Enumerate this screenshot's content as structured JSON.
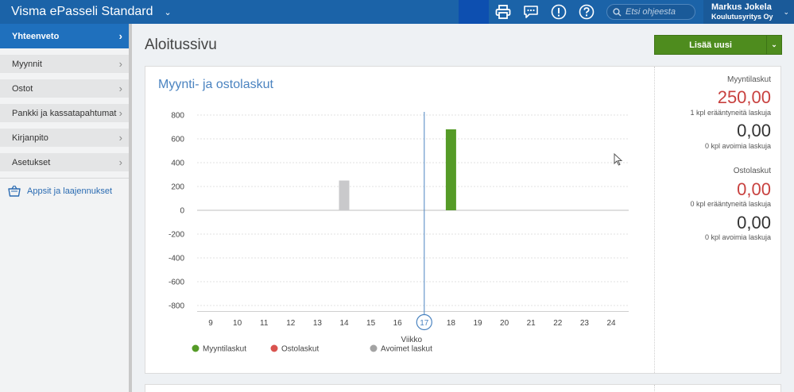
{
  "app": {
    "title": "Visma ePasseli Standard"
  },
  "topbar": {
    "icons": [
      "printer-icon",
      "chat-icon",
      "alert-icon",
      "help-icon"
    ],
    "search_placeholder": "Etsi ohjeesta",
    "user_name": "Markus Jokela",
    "company": "Koulutusyritys Oy"
  },
  "sidebar": {
    "items": [
      {
        "label": "Yhteenveto",
        "active": true
      },
      {
        "label": "Myynnit"
      },
      {
        "label": "Ostot"
      },
      {
        "label": "Pankki ja kassatapahtumat"
      },
      {
        "label": "Kirjanpito"
      },
      {
        "label": "Asetukset"
      }
    ],
    "apps_label": "Appsit ja laajennukset"
  },
  "main": {
    "page_title": "Aloitussivu",
    "add_button": "Lisää uusi",
    "card_title": "Myynti- ja ostolaskut"
  },
  "stats": {
    "sales_heading": "Myyntilaskut",
    "sales_overdue_amount": "250,00",
    "sales_overdue_label": "1 kpl erääntyneitä laskuja",
    "sales_open_amount": "0,00",
    "sales_open_label": "0 kpl avoimia laskuja",
    "purchases_heading": "Ostolaskut",
    "purchases_overdue_amount": "0,00",
    "purchases_overdue_label": "0 kpl erääntyneitä laskuja",
    "purchases_open_amount": "0,00",
    "purchases_open_label": "0 kpl avoimia laskuja"
  },
  "colors": {
    "topbar": "#1b63a8",
    "sales": "#559b27",
    "purchases": "#d9534f",
    "open": "#a3a3a3",
    "accent": "#4a83c0"
  },
  "chart_data": {
    "type": "bar",
    "title": "Myynti- ja ostolaskut",
    "xlabel": "Viikko",
    "ylabel": "",
    "categories": [
      "9",
      "10",
      "11",
      "12",
      "13",
      "14",
      "15",
      "16",
      "17",
      "18",
      "19",
      "20",
      "21",
      "22",
      "23",
      "24"
    ],
    "ylim": [
      -850,
      850
    ],
    "yticks": [
      800,
      600,
      400,
      200,
      0,
      -200,
      -400,
      -600,
      -800
    ],
    "current_week": "17",
    "series": [
      {
        "name": "Myyntilaskut",
        "color": "#559b27",
        "values": [
          0,
          0,
          0,
          0,
          0,
          0,
          0,
          0,
          0,
          680,
          0,
          0,
          0,
          0,
          0,
          0
        ]
      },
      {
        "name": "Ostolaskut",
        "color": "#d9534f",
        "values": [
          0,
          0,
          0,
          0,
          0,
          0,
          0,
          0,
          0,
          0,
          0,
          0,
          0,
          0,
          0,
          0
        ]
      },
      {
        "name": "Avoimet laskut",
        "color": "#c9c9cb",
        "values": [
          0,
          0,
          0,
          0,
          0,
          250,
          0,
          0,
          0,
          0,
          0,
          0,
          0,
          0,
          0,
          0
        ]
      }
    ],
    "legend": "bottom-left",
    "grid": true
  }
}
